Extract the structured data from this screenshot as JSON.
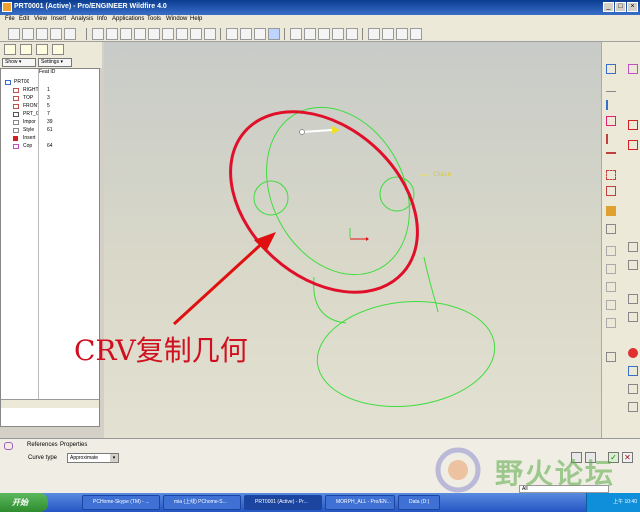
{
  "window": {
    "title": "PRT0001 (Active) - Pro/ENGINEER Wildfire 4.0"
  },
  "menu": [
    "File",
    "Edit",
    "View",
    "Insert",
    "Analysis",
    "Info",
    "Applications",
    "Tools",
    "Window",
    "Help"
  ],
  "model_tree": {
    "show_label": "Show ▾",
    "settings_label": "Settings ▾",
    "column_header": "Feat ID",
    "rows": [
      {
        "name": "PRT0001.",
        "id": "",
        "icon": "part-icon"
      },
      {
        "name": "RIGHT",
        "id": "1",
        "icon": "datum-plane-icon"
      },
      {
        "name": "TOP",
        "id": "3",
        "icon": "datum-plane-icon"
      },
      {
        "name": "FRONT",
        "id": "5",
        "icon": "datum-plane-icon"
      },
      {
        "name": "PRT_C",
        "id": "7",
        "icon": "csys-icon"
      },
      {
        "name": "Impor",
        "id": "39",
        "icon": "import-icon"
      },
      {
        "name": "Style",
        "id": "61",
        "icon": "style-icon"
      },
      {
        "name": "Insert",
        "id": "",
        "icon": "insert-here-icon"
      },
      {
        "name": "Cop",
        "id": "64",
        "icon": "copy-geom-icon"
      }
    ]
  },
  "viewport": {
    "annotation": "CRV复制几何",
    "chain_label": "Chain"
  },
  "dashboard": {
    "tabs": [
      "References",
      "Properties"
    ],
    "curve_type_label": "Curve type",
    "curve_type_value": "Approximate",
    "filter_value": "All"
  },
  "watermark": "野火论坛",
  "taskbar": {
    "start_label": "开始",
    "tasks": [
      "PCHome-Skype (TM) - ...",
      "mia (上线) PChome-S...",
      "PRT0001 (Active) - Pr...",
      "MORPH_ALL - Pro/EN...",
      "Data (D:)"
    ],
    "clock": "上午 10:40"
  },
  "colors": {
    "highlight_curve": "#e0102a",
    "geometry_curve": "#3fdc3f",
    "annotation_text": "#d01020",
    "arrow": "#e01010"
  }
}
